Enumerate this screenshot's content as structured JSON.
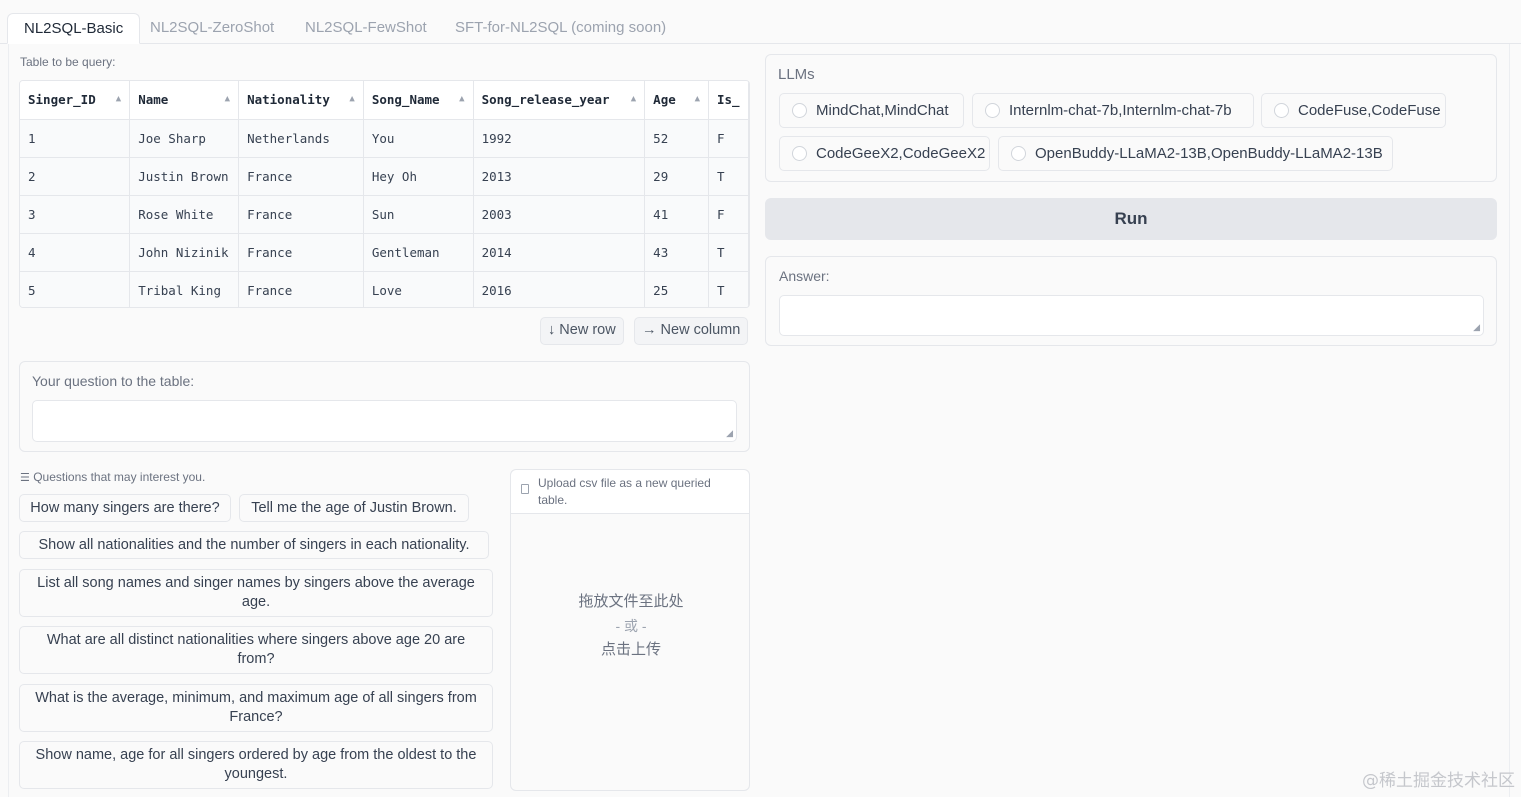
{
  "tabs": [
    "NL2SQL-Basic",
    "NL2SQL-ZeroShot",
    "NL2SQL-FewShot",
    "SFT-for-NL2SQL (coming soon)"
  ],
  "table_label": "Table to be query:",
  "table": {
    "headers": [
      "Singer_ID",
      "Name",
      "Nationality",
      "Song_Name",
      "Song_release_year",
      "Age",
      "Is_"
    ],
    "rows": [
      [
        "1",
        "Joe Sharp",
        "Netherlands",
        "You",
        "1992",
        "52",
        "F"
      ],
      [
        "2",
        "Justin Brown",
        "France",
        "Hey Oh",
        "2013",
        "29",
        "T"
      ],
      [
        "3",
        "Rose White",
        "France",
        "Sun",
        "2003",
        "41",
        "F"
      ],
      [
        "4",
        "John Nizinik",
        "France",
        "Gentleman",
        "2014",
        "43",
        "T"
      ],
      [
        "5",
        "Tribal King",
        "France",
        "Love",
        "2016",
        "25",
        "T"
      ]
    ]
  },
  "new_row": "↓ New row",
  "new_column": "→ New column",
  "question_label": "Your question to the table:",
  "question_value": "",
  "examples_label": "Questions that may interest you.",
  "examples": [
    "How many singers are there?",
    "Tell me the age of Justin Brown.",
    "Show all nationalities and the number of singers in each nationality.",
    "List all song names and singer names by singers above the average age.",
    "What are all distinct nationalities where singers above age 20 are from?",
    "What is the average, minimum, and maximum age of all singers from France?",
    "Show name, age for all singers ordered by age from the oldest to the youngest."
  ],
  "upload": {
    "label": "Upload csv file as a new queried table.",
    "drop_text": "拖放文件至此处",
    "or_text": "- 或 -",
    "click_text": "点击上传"
  },
  "llms_label": "LLMs",
  "llms": [
    "MindChat,MindChat",
    "Internlm-chat-7b,Internlm-chat-7b",
    "CodeFuse,CodeFuse",
    "CodeGeeX2,CodeGeeX2",
    "OpenBuddy-LLaMA2-13B,OpenBuddy-LLaMA2-13B"
  ],
  "run_label": "Run",
  "answer_label": "Answer:",
  "answer_value": "",
  "watermark": "@稀土掘金技术社区"
}
